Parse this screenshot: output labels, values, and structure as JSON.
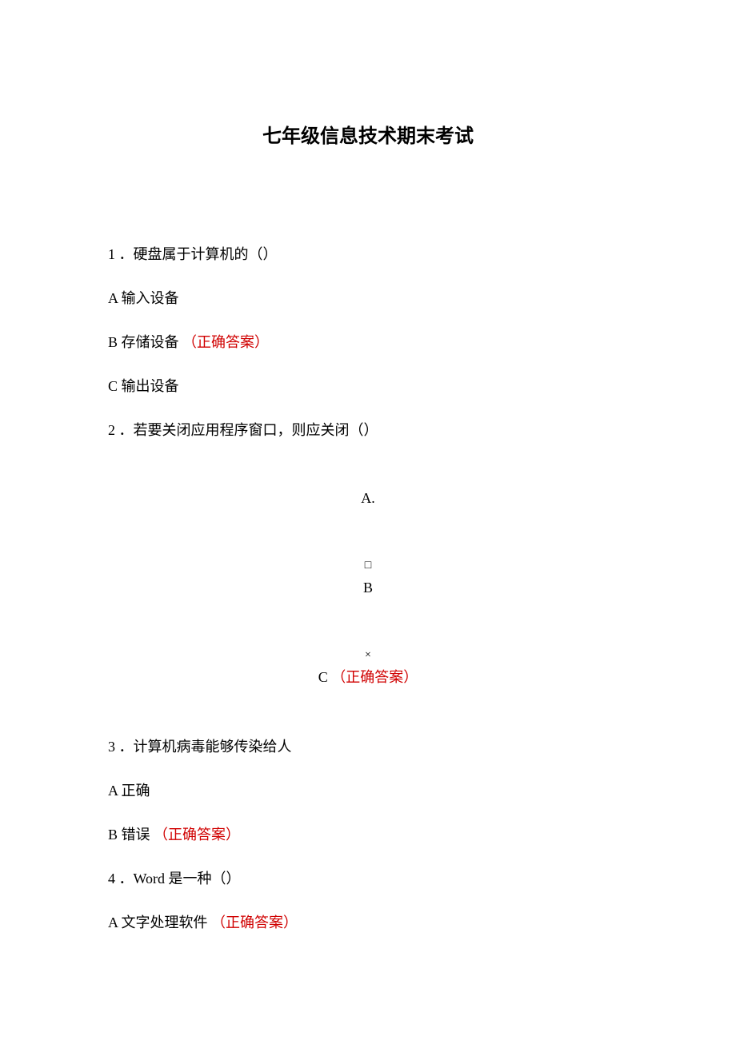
{
  "title": "七年级信息技术期末考试",
  "q1": {
    "num": "1",
    "text": "．硬盘属于计算机的（）",
    "a": "A 输入设备",
    "b": "B 存储设备",
    "b_mark": "（正确答案）",
    "c": "C 输出设备"
  },
  "q2": {
    "num": "2",
    "text": "．若要关闭应用程序窗口，则应关闭（）",
    "a_label": "A.",
    "b_symbol": "□",
    "b_label": "B",
    "c_symbol": "×",
    "c_label": "C",
    "c_mark": "（正确答案）"
  },
  "q3": {
    "num": "3",
    "text": "．计算机病毒能够传染给人",
    "a": "A 正确",
    "b": "B 错误",
    "b_mark": "（正确答案）"
  },
  "q4": {
    "num": "4",
    "text": "．Word 是一种（）",
    "a": "A 文字处理软件",
    "a_mark": "（正确答案）"
  }
}
